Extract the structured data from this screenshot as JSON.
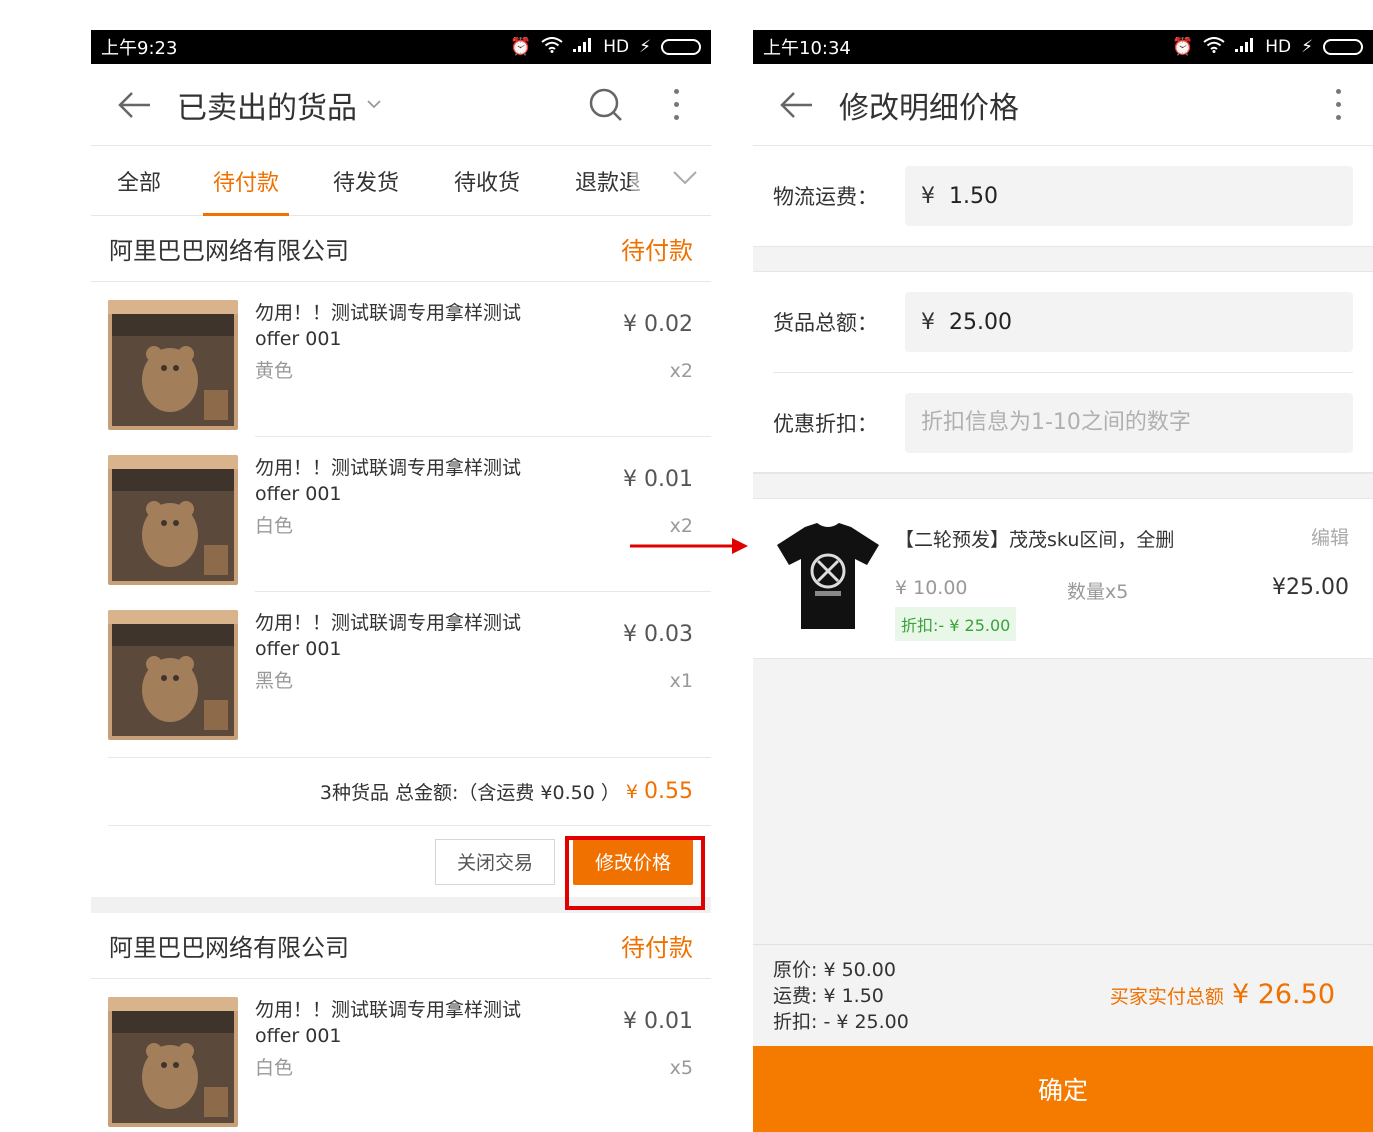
{
  "left": {
    "status_time": "上午9:23",
    "status_network": "HD",
    "title": "已卖出的货品",
    "tabs": [
      {
        "label": "全部",
        "active": false
      },
      {
        "label": "待付款",
        "active": true
      },
      {
        "label": "待发货",
        "active": false
      },
      {
        "label": "待收货",
        "active": false
      },
      {
        "label": "退款退",
        "active": false
      }
    ],
    "orders": [
      {
        "seller": "阿里巴巴网络有限公司",
        "status": "待付款",
        "items": [
          {
            "name": "勿用！！测试联调专用拿样测试offer 001",
            "spec": "黄色",
            "price": "¥ 0.02",
            "qty": "x2"
          },
          {
            "name": "勿用！！测试联调专用拿样测试offer 001",
            "spec": "白色",
            "price": "¥ 0.01",
            "qty": "x2"
          },
          {
            "name": "勿用！！测试联调专用拿样测试offer 001",
            "spec": "黑色",
            "price": "¥ 0.03",
            "qty": "x1"
          }
        ],
        "summary_text": "3种货品 总金额:（含运费 ¥0.50 ）",
        "summary_currency": "¥",
        "summary_amount": "0.55",
        "btn_close": "关闭交易",
        "btn_modify": "修改价格"
      },
      {
        "seller": "阿里巴巴网络有限公司",
        "status": "待付款",
        "items": [
          {
            "name": "勿用！！测试联调专用拿样测试offer 001",
            "spec": "白色",
            "price": "¥ 0.01",
            "qty": "x5"
          }
        ]
      }
    ]
  },
  "right": {
    "status_time": "上午10:34",
    "status_network": "HD",
    "title": "修改明细价格",
    "shipping_label": "物流运费：",
    "shipping_currency": "¥",
    "shipping_value": "1.50",
    "goods_label": "货品总额：",
    "goods_currency": "¥",
    "goods_value": "25.00",
    "discount_label": "优惠折扣：",
    "discount_placeholder": "折扣信息为1-10之间的数字",
    "product": {
      "title": "【二轮预发】茂茂sku区间，全删",
      "edit": "编辑",
      "orig_price": "¥ 10.00",
      "qty": "数量x5",
      "total": "¥25.00",
      "discount": "折扣:- ¥ 25.00"
    },
    "summary": {
      "orig": "原价: ¥ 50.00",
      "shipping": "运费: ¥ 1.50",
      "discount": "折扣: - ¥ 25.00",
      "pay_label": "买家实付总额",
      "pay_amount": "¥ 26.50"
    },
    "confirm": "确定"
  },
  "colors": {
    "accent": "#f07000",
    "highlight": "#e00000",
    "discount_green": "#3aa23a"
  }
}
